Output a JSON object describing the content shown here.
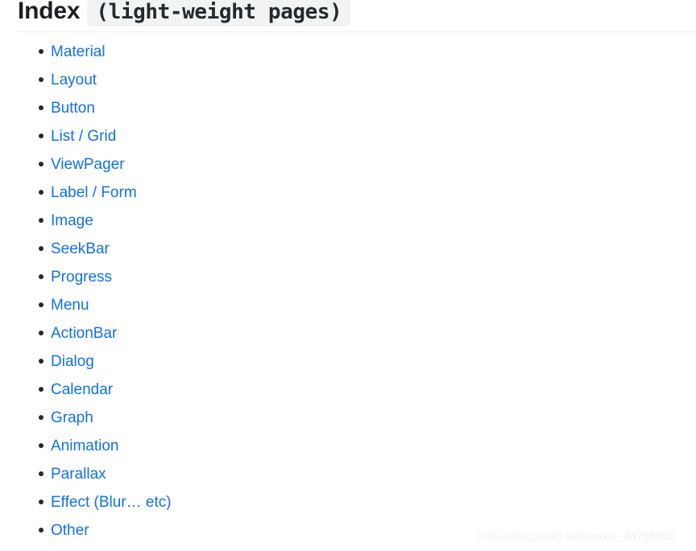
{
  "heading": {
    "title": "Index",
    "code_badge": "(light-weight pages)"
  },
  "index": {
    "items": [
      {
        "label": "Material"
      },
      {
        "label": "Layout"
      },
      {
        "label": "Button"
      },
      {
        "label": "List / Grid"
      },
      {
        "label": "ViewPager"
      },
      {
        "label": "Label / Form"
      },
      {
        "label": "Image"
      },
      {
        "label": "SeekBar"
      },
      {
        "label": "Progress"
      },
      {
        "label": "Menu"
      },
      {
        "label": "ActionBar"
      },
      {
        "label": "Dialog"
      },
      {
        "label": "Calendar"
      },
      {
        "label": "Graph"
      },
      {
        "label": "Animation"
      },
      {
        "label": "Parallax"
      },
      {
        "label": "Effect (Blur… etc)"
      },
      {
        "label": "Other"
      }
    ]
  },
  "watermark": {
    "text": "https://blog.csdn.net/weixin_44758662"
  },
  "colors": {
    "link": "#1270e8",
    "heading_text": "#1b1f23",
    "code_badge_background": "#f2f4f4",
    "rule": "#eaecef",
    "bullet": "#24292e",
    "page_background": "#ffffff",
    "watermark": "#f0f0f0"
  }
}
